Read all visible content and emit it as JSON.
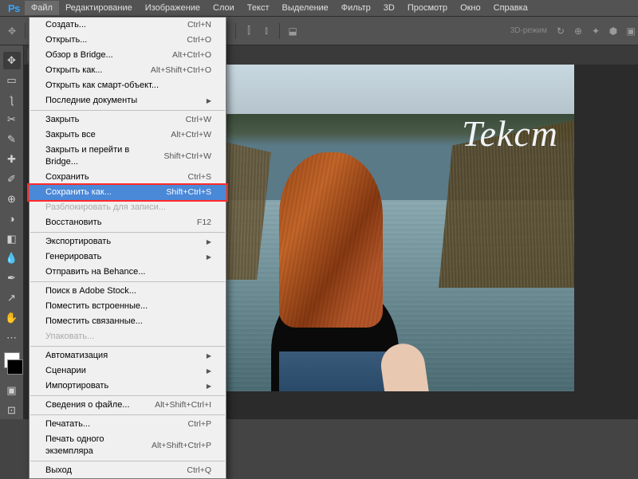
{
  "app": {
    "logo": "Ps"
  },
  "menubar": [
    "Файл",
    "Редактирование",
    "Изображение",
    "Слои",
    "Текст",
    "Выделение",
    "Фильтр",
    "3D",
    "Просмотр",
    "Окно",
    "Справка"
  ],
  "canvas_text": "Tekcm",
  "three_d_label": "3D-режим",
  "dropdown": {
    "groups": [
      [
        {
          "label": "Создать...",
          "shortcut": "Ctrl+N"
        },
        {
          "label": "Открыть...",
          "shortcut": "Ctrl+O"
        },
        {
          "label": "Обзор в Bridge...",
          "shortcut": "Alt+Ctrl+O"
        },
        {
          "label": "Открыть как...",
          "shortcut": "Alt+Shift+Ctrl+O"
        },
        {
          "label": "Открыть как смарт-объект..."
        },
        {
          "label": "Последние документы",
          "submenu": true
        }
      ],
      [
        {
          "label": "Закрыть",
          "shortcut": "Ctrl+W"
        },
        {
          "label": "Закрыть все",
          "shortcut": "Alt+Ctrl+W"
        },
        {
          "label": "Закрыть и перейти в Bridge...",
          "shortcut": "Shift+Ctrl+W"
        },
        {
          "label": "Сохранить",
          "shortcut": "Ctrl+S"
        },
        {
          "label": "Сохранить как...",
          "shortcut": "Shift+Ctrl+S",
          "highlighted": true,
          "redbox": true
        },
        {
          "label": "Разблокировать для записи...",
          "disabled": true
        },
        {
          "label": "Восстановить",
          "shortcut": "F12"
        }
      ],
      [
        {
          "label": "Экспортировать",
          "submenu": true
        },
        {
          "label": "Генерировать",
          "submenu": true
        },
        {
          "label": "Отправить на Behance..."
        }
      ],
      [
        {
          "label": "Поиск в Adobe Stock..."
        },
        {
          "label": "Поместить встроенные..."
        },
        {
          "label": "Поместить связанные..."
        },
        {
          "label": "Упаковать...",
          "disabled": true
        }
      ],
      [
        {
          "label": "Автоматизация",
          "submenu": true
        },
        {
          "label": "Сценарии",
          "submenu": true
        },
        {
          "label": "Импортировать",
          "submenu": true
        }
      ],
      [
        {
          "label": "Сведения о файле...",
          "shortcut": "Alt+Shift+Ctrl+I"
        }
      ],
      [
        {
          "label": "Печатать...",
          "shortcut": "Ctrl+P"
        },
        {
          "label": "Печать одного экземпляра",
          "shortcut": "Alt+Shift+Ctrl+P"
        }
      ],
      [
        {
          "label": "Выход",
          "shortcut": "Ctrl+Q"
        }
      ]
    ]
  }
}
